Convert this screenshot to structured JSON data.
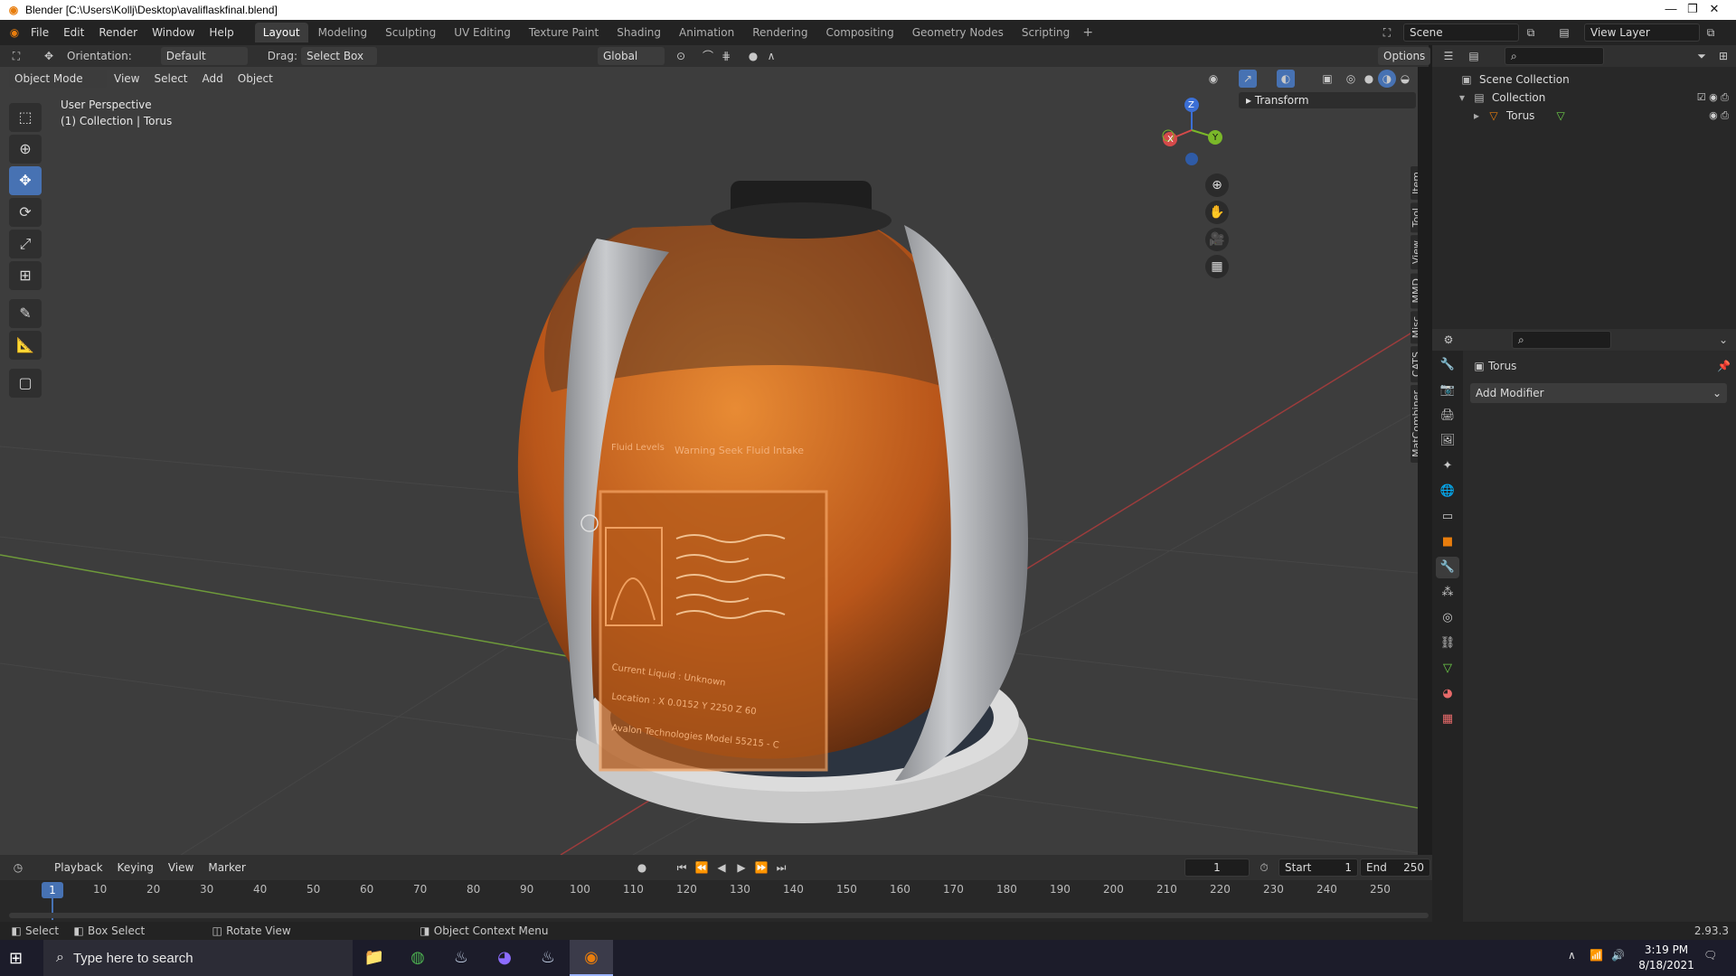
{
  "titlebar": {
    "title": "Blender [C:\\Users\\Kollj\\Desktop\\avaliflaskfinal.blend]",
    "minimize": "—",
    "restore": "❐",
    "close": "✕"
  },
  "menu": {
    "items": [
      "File",
      "Edit",
      "Render",
      "Window",
      "Help"
    ],
    "workspaces": [
      "Layout",
      "Modeling",
      "Sculpting",
      "UV Editing",
      "Texture Paint",
      "Shading",
      "Animation",
      "Rendering",
      "Compositing",
      "Geometry Nodes",
      "Scripting"
    ],
    "active_workspace": "Layout",
    "add": "+",
    "scene": "Scene",
    "view_layer": "View Layer"
  },
  "header": {
    "orientation_label": "Orientation:",
    "orientation_value": "Default",
    "drag_label": "Drag:",
    "drag_value": "Select Box",
    "transform_orientation": "Global",
    "options": "Options"
  },
  "viewport": {
    "mode": "Object Mode",
    "menus": [
      "View",
      "Select",
      "Add",
      "Object"
    ],
    "perspective": "User Perspective",
    "collection_info": "(1) Collection | Torus",
    "transform_panel": "Transform",
    "side_tabs": [
      "Item",
      "Tool",
      "View",
      "MMD",
      "Misc",
      "CATS",
      "MatCombiner"
    ],
    "gizmo": {
      "x": "X",
      "y": "Y",
      "z": "Z"
    },
    "label": {
      "col1": "Fluid Levels",
      "col2": "Warning  Seek Fluid Intake",
      "line1": "Current Liquid : Unknown",
      "line2": "Location : X 0.0152  Y 2250  Z  60",
      "line3": "Avalon Technologies  Model  55215 - C"
    }
  },
  "outliner": {
    "scene_collection": "Scene Collection",
    "collection": "Collection",
    "object": "Torus"
  },
  "properties": {
    "object_name": "Torus",
    "add_modifier": "Add Modifier"
  },
  "timeline": {
    "menus": [
      "Playback",
      "Keying",
      "View",
      "Marker"
    ],
    "current_frame": "1",
    "start_label": "Start",
    "start": "1",
    "end_label": "End",
    "end": "250",
    "ticks": [
      "10",
      "20",
      "30",
      "40",
      "50",
      "60",
      "70",
      "80",
      "90",
      "100",
      "110",
      "120",
      "130",
      "140",
      "150",
      "160",
      "170",
      "180",
      "190",
      "200",
      "210",
      "220",
      "230",
      "240",
      "250"
    ],
    "cursor": "1"
  },
  "status": {
    "select": "Select",
    "box_select": "Box Select",
    "rotate_view": "Rotate View",
    "context_menu": "Object Context Menu",
    "version": "2.93.3"
  },
  "taskbar": {
    "search_placeholder": "Type here to search",
    "time": "3:19 PM",
    "date": "8/18/2021"
  },
  "colors": {
    "accent": "#4772b3",
    "blender_orange": "#e87d0d",
    "liquid": "#c8641a"
  }
}
